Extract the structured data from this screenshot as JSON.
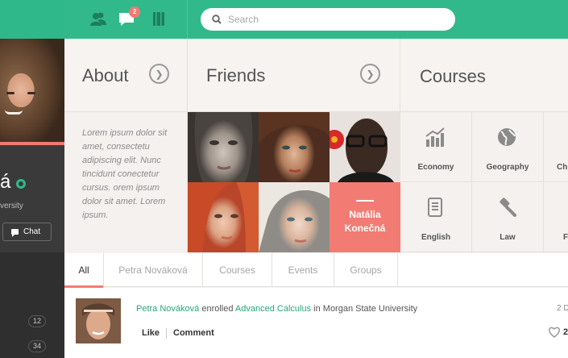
{
  "profile": {
    "name_fragment": "á",
    "university_fragment": "versity",
    "chat_label": "Chat",
    "counts": [
      "12",
      "34"
    ]
  },
  "topbar": {
    "notification_count": "2",
    "search_placeholder": "Search"
  },
  "sections": {
    "about": "About",
    "friends": "Friends",
    "courses": "Courses"
  },
  "about_text": "Lorem ipsum dolor sit amet, consectetu adipiscing elit. Nunc tincidunt conectetur cursus. orem ipsum dolor sit amet. Lorem ipsum.",
  "friends_highlight": {
    "first": "Natália",
    "last": "Konečná"
  },
  "courses": [
    {
      "label": "Economy",
      "icon": "chart-icon"
    },
    {
      "label": "Geography",
      "icon": "globe-icon"
    },
    {
      "label": "Ch",
      "icon": ""
    },
    {
      "label": "English",
      "icon": "book-icon"
    },
    {
      "label": "Law",
      "icon": "gavel-icon"
    },
    {
      "label": "F",
      "icon": ""
    }
  ],
  "tabs": [
    {
      "label": "All",
      "active": true
    },
    {
      "label": "Petra Nováková",
      "active": false
    },
    {
      "label": "Courses",
      "active": false
    },
    {
      "label": "Events",
      "active": false
    },
    {
      "label": "Groups",
      "active": false
    }
  ],
  "feed": {
    "user": "Petra Nováková",
    "verb": "enrolled",
    "course": "Advanced Calculus",
    "prep": "in",
    "place": "Morgan State University",
    "date_fragment": "2 D",
    "like_label": "Like",
    "comment_label": "Comment",
    "likes_count": "2"
  },
  "colors": {
    "brand_green": "#31b98b",
    "accent_coral": "#f27c74",
    "sidebar_dark": "#3a3a3a"
  }
}
